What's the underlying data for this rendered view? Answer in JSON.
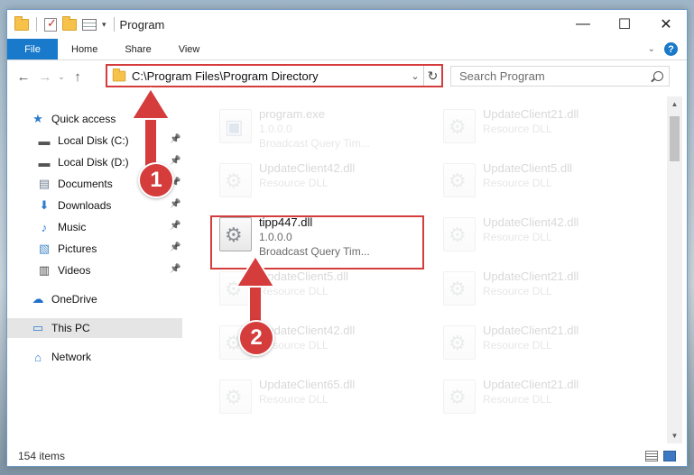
{
  "window": {
    "title": "Program"
  },
  "ribbon": {
    "tabs": [
      "File",
      "Home",
      "Share",
      "View"
    ],
    "help": "?"
  },
  "address_bar": {
    "path": "C:\\Program Files\\Program Directory"
  },
  "search": {
    "placeholder": "Search Program"
  },
  "sidebar": {
    "items": [
      {
        "label": "Quick access",
        "icon": "star-icon",
        "pinned": false
      },
      {
        "label": "Local Disk (C:)",
        "icon": "drive-icon",
        "pinned": true
      },
      {
        "label": "Local Disk (D:)",
        "icon": "drive-icon",
        "pinned": true
      },
      {
        "label": "Documents",
        "icon": "documents-icon",
        "pinned": true
      },
      {
        "label": "Downloads",
        "icon": "download-icon",
        "pinned": true
      },
      {
        "label": "Music",
        "icon": "music-icon",
        "pinned": true
      },
      {
        "label": "Pictures",
        "icon": "pictures-icon",
        "pinned": true
      },
      {
        "label": "Videos",
        "icon": "videos-icon",
        "pinned": true
      },
      {
        "label": "OneDrive",
        "icon": "cloud-icon",
        "pinned": false
      },
      {
        "label": "This PC",
        "icon": "computer-icon",
        "pinned": false,
        "selected": true
      },
      {
        "label": "Network",
        "icon": "network-icon",
        "pinned": false
      }
    ]
  },
  "files": [
    {
      "name": "program.exe",
      "line2": "1.0.0.0",
      "line3": "Broadcast Query Tim...",
      "faded": true,
      "icon": "exe-icon"
    },
    {
      "name": "UpdateClient21.dll",
      "line2": "Resource DLL",
      "line3": "",
      "faded": true,
      "icon": "dll-icon"
    },
    {
      "name": "UpdateClient42.dll",
      "line2": "Resource DLL",
      "line3": "",
      "faded": true,
      "icon": "dll-icon"
    },
    {
      "name": "UpdateClient5.dll",
      "line2": "Resource DLL",
      "line3": "",
      "faded": true,
      "icon": "dll-icon"
    },
    {
      "name": "tipp447.dll",
      "line2": "1.0.0.0",
      "line3": "Broadcast Query Tim...",
      "faded": false,
      "icon": "dll-icon"
    },
    {
      "name": "UpdateClient42.dll",
      "line2": "Resource DLL",
      "line3": "",
      "faded": true,
      "icon": "dll-icon"
    },
    {
      "name": "UpdateClient5.dll",
      "line2": "Resource DLL",
      "line3": "",
      "faded": true,
      "icon": "dll-icon"
    },
    {
      "name": "UpdateClient21.dll",
      "line2": "Resource DLL",
      "line3": "",
      "faded": true,
      "icon": "dll-icon"
    },
    {
      "name": "UpdateClient42.dll",
      "line2": "Resource DLL",
      "line3": "",
      "faded": true,
      "icon": "dll-icon"
    },
    {
      "name": "UpdateClient21.dll",
      "line2": "Resource DLL",
      "line3": "",
      "faded": true,
      "icon": "dll-icon"
    },
    {
      "name": "UpdateClient65.dll",
      "line2": "Resource DLL",
      "line3": "",
      "faded": true,
      "icon": "dll-icon"
    },
    {
      "name": "UpdateClient21.dll",
      "line2": "Resource DLL",
      "line3": "",
      "faded": true,
      "icon": "dll-icon"
    }
  ],
  "status": {
    "item_count": "154 items"
  },
  "annotations": {
    "step1": "1",
    "step2": "2",
    "color": "#d53c3c"
  }
}
